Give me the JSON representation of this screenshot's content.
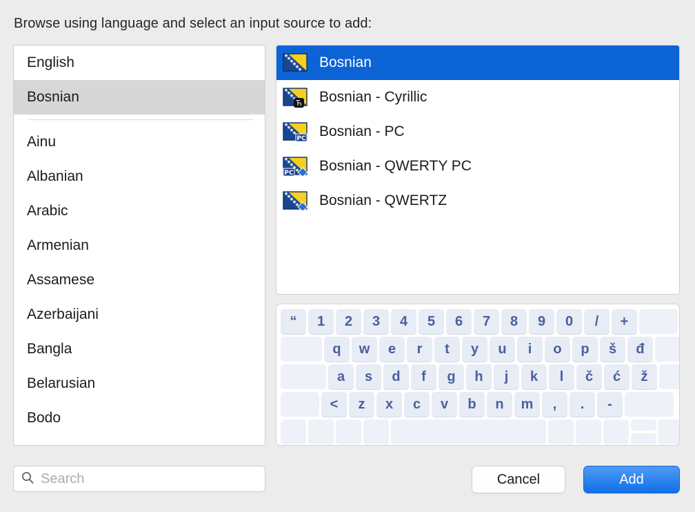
{
  "header": {
    "prompt": "Browse using language and select an input source to add:"
  },
  "colors": {
    "window_background": "#ececec",
    "selection_active": "#0b63d6",
    "selection_inactive": "#d7d7d7",
    "add_button_blue": "#126fe8",
    "key_text": "#4a5f9e",
    "flag_blue": "#18478f",
    "flag_yellow": "#f7cf1d"
  },
  "language_list": {
    "pinned": [
      {
        "label": "English",
        "selected": false
      },
      {
        "label": "Bosnian",
        "selected": true
      }
    ],
    "items": [
      {
        "label": "Ainu",
        "selected": false
      },
      {
        "label": "Albanian",
        "selected": false
      },
      {
        "label": "Arabic",
        "selected": false
      },
      {
        "label": "Armenian",
        "selected": false
      },
      {
        "label": "Assamese",
        "selected": false
      },
      {
        "label": "Azerbaijani",
        "selected": false
      },
      {
        "label": "Bangla",
        "selected": false
      },
      {
        "label": "Belarusian",
        "selected": false
      },
      {
        "label": "Bodo",
        "selected": false
      }
    ]
  },
  "input_source_list": {
    "items": [
      {
        "label": "Bosnian",
        "icon": "flag-bosnia-icon",
        "badge": "none",
        "selected": true
      },
      {
        "label": "Bosnian - Cyrillic",
        "icon": "flag-bosnia-icon",
        "badge": "cyrillic",
        "badge_text": "Ћ",
        "selected": false
      },
      {
        "label": "Bosnian - PC",
        "icon": "flag-bosnia-icon",
        "badge": "pc",
        "badge_text": "PC",
        "selected": false
      },
      {
        "label": "Bosnian - QWERTY PC",
        "icon": "flag-bosnia-icon",
        "badge": "pc-diamond",
        "badge_text": "PC",
        "selected": false
      },
      {
        "label": "Bosnian - QWERTZ",
        "icon": "flag-bosnia-icon",
        "badge": "diamond",
        "selected": false
      }
    ]
  },
  "keyboard_preview": {
    "rows": [
      {
        "keys": [
          {
            "label": "“",
            "width": "w100"
          },
          {
            "label": "1",
            "width": "w100"
          },
          {
            "label": "2",
            "width": "w100"
          },
          {
            "label": "3",
            "width": "w100"
          },
          {
            "label": "4",
            "width": "w100"
          },
          {
            "label": "5",
            "width": "w100"
          },
          {
            "label": "6",
            "width": "w100"
          },
          {
            "label": "7",
            "width": "w100"
          },
          {
            "label": "8",
            "width": "w100"
          },
          {
            "label": "9",
            "width": "w100"
          },
          {
            "label": "0",
            "width": "w100"
          },
          {
            "label": "/",
            "width": "w100"
          },
          {
            "label": "+",
            "width": "w100"
          },
          {
            "label": "",
            "width": "w150",
            "blank": true
          }
        ]
      },
      {
        "keys": [
          {
            "label": "",
            "width": "w160",
            "blank": true
          },
          {
            "label": "q",
            "width": "w100"
          },
          {
            "label": "w",
            "width": "w100"
          },
          {
            "label": "e",
            "width": "w100"
          },
          {
            "label": "r",
            "width": "w100"
          },
          {
            "label": "t",
            "width": "w100"
          },
          {
            "label": "y",
            "width": "w100"
          },
          {
            "label": "u",
            "width": "w100"
          },
          {
            "label": "i",
            "width": "w100"
          },
          {
            "label": "o",
            "width": "w100"
          },
          {
            "label": "p",
            "width": "w100"
          },
          {
            "label": "š",
            "width": "w100"
          },
          {
            "label": "đ",
            "width": "w100"
          },
          {
            "label": "",
            "width": "w100",
            "blank": true
          }
        ]
      },
      {
        "keys": [
          {
            "label": "",
            "width": "w175",
            "blank": true
          },
          {
            "label": "a",
            "width": "w100"
          },
          {
            "label": "s",
            "width": "w100"
          },
          {
            "label": "d",
            "width": "w100"
          },
          {
            "label": "f",
            "width": "w100"
          },
          {
            "label": "g",
            "width": "w100"
          },
          {
            "label": "h",
            "width": "w100"
          },
          {
            "label": "j",
            "width": "w100"
          },
          {
            "label": "k",
            "width": "w100"
          },
          {
            "label": "l",
            "width": "w100"
          },
          {
            "label": "č",
            "width": "w100"
          },
          {
            "label": "ć",
            "width": "w100"
          },
          {
            "label": "ž",
            "width": "w100"
          },
          {
            "label": "",
            "width": "w100",
            "blank": true
          }
        ]
      },
      {
        "keys": [
          {
            "label": "",
            "width": "w150",
            "blank": true
          },
          {
            "label": "<",
            "width": "w100"
          },
          {
            "label": "z",
            "width": "w100"
          },
          {
            "label": "x",
            "width": "w100"
          },
          {
            "label": "c",
            "width": "w100"
          },
          {
            "label": "v",
            "width": "w100"
          },
          {
            "label": "b",
            "width": "w100"
          },
          {
            "label": "n",
            "width": "w100"
          },
          {
            "label": "m",
            "width": "w100"
          },
          {
            "label": ",",
            "width": "w100"
          },
          {
            "label": ".",
            "width": "w100"
          },
          {
            "label": "-",
            "width": "w100"
          },
          {
            "label": "",
            "width": "w190",
            "blank": true
          }
        ]
      },
      {
        "keys": [
          {
            "label": "",
            "width": "w100",
            "blank": true
          },
          {
            "label": "",
            "width": "w100",
            "blank": true
          },
          {
            "label": "",
            "width": "w100",
            "blank": true
          },
          {
            "label": "",
            "width": "w100",
            "blank": true
          },
          {
            "label": "",
            "width": "w600",
            "blank": true
          },
          {
            "label": "",
            "width": "w100",
            "blank": true
          },
          {
            "label": "",
            "width": "w100",
            "blank": true
          },
          {
            "label": "",
            "width": "w100",
            "blank": true
          },
          {
            "label": "",
            "width": "w100",
            "blank": true,
            "arrows": true
          },
          {
            "label": "",
            "width": "w100",
            "blank": true
          }
        ]
      }
    ]
  },
  "search": {
    "placeholder": "Search",
    "value": "",
    "icon": "search-icon"
  },
  "footer": {
    "cancel_label": "Cancel",
    "add_label": "Add"
  }
}
